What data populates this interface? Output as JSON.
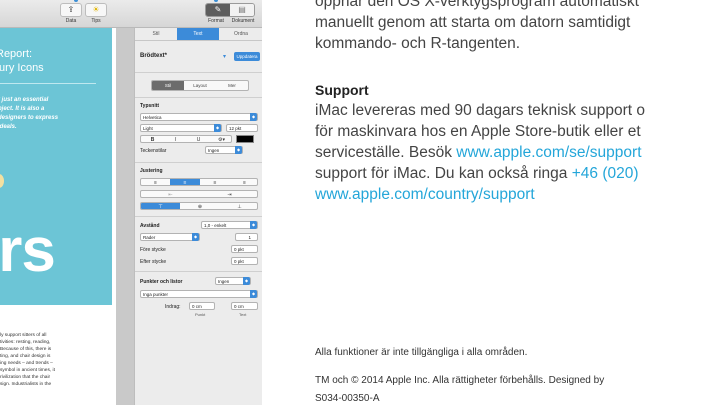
{
  "toolbar": {
    "data_icon_glyph": "⇪",
    "data_label": "Data",
    "tips_icon_glyph": "☀",
    "tips_label": "Tips",
    "format_label": "Format",
    "document_label": "Dokument",
    "format_icon_glyph": "✎",
    "document_icon_glyph": "▤"
  },
  "document": {
    "title_line1": "Report:",
    "title_line2": "tury Icons",
    "quote_lines": [
      "t just an essential",
      "bject. It is also a",
      "designers to express",
      "ideals."
    ],
    "big_word": "irs",
    "body_lines": [
      "ly support sitters of all",
      "tivities: resting, reading,",
      "Because of this, there is",
      "ting, and chair design is",
      "ing needs – and trends –",
      "symbol in ancient times, it",
      "rivilization that the chair",
      "sign. Industrialists in the"
    ],
    "colors": {
      "cover": "#6cc5d6"
    }
  },
  "inspector": {
    "tabs": [
      "Stil",
      "Text",
      "Ordna"
    ],
    "active_tab": "Text",
    "paragraph_style": "Brödtext*",
    "chevron_glyph": "▾",
    "update_button": "Uppdatera",
    "subtabs": [
      "Stil",
      "Layout",
      "Mer"
    ],
    "font_section": "Typsnitt",
    "font_family": "Helvetica",
    "font_weight": "Light",
    "font_size": "12 pkt",
    "style_buttons": [
      "B",
      "I",
      "U",
      "⚙▾"
    ],
    "char_styles_label": "Teckenstilar",
    "char_styles_value": "Ingen",
    "alignment_section": "Justering",
    "align_buttons": [
      "≡",
      "≡",
      "≡",
      "≡"
    ],
    "indent_buttons": [
      "⇤",
      "⇥"
    ],
    "vertical_buttons": [
      "⊤",
      "⊕",
      "⊥"
    ],
    "spacing_label": "Avstånd",
    "spacing_value": "1,0 - enkelt",
    "spacing_mode": "Rader",
    "spacing_lines": "1",
    "before_label": "Före stycke",
    "before_value": "0 pkt",
    "after_label": "Efter stycke",
    "after_value": "0 pkt",
    "bullets_label": "Punkter och listor",
    "bullets_value": "Ingen",
    "bullets_popup": "Inga punkter",
    "indent_label": "Indrag:",
    "indent_bullet_value": "0 cm",
    "indent_text_value": "0 cm",
    "indent_bullet_caption": "Punkt",
    "indent_text_caption": "Text",
    "accent": "#3c8bd9"
  },
  "manual": {
    "line0": "öppnar den OS X-verktygsprogram automatiskt",
    "line1": "manuellt genom att starta om datorn samtidigt",
    "line2": "kommando- och R-tangenten.",
    "support_heading": "Support",
    "support_line1": "iMac levereras med 90 dagars teknisk support o",
    "support_line2": "för maskinvara hos en Apple Store-butik eller et",
    "support_line3a": "serviceställe. Besök ",
    "support_link1": "www.apple.com/se/support",
    "support_line4a": "support för iMac. Du kan också ringa ",
    "support_phone": "+46 (020)",
    "support_link2": "www.apple.com/country/support",
    "footnote": "Alla funktioner är inte tillgängliga i alla områden.",
    "legal_line1": "TM och © 2014 Apple Inc. Alla rättigheter förbehålls. Designed by",
    "legal_line2": "S034-00350-A",
    "link_color": "#24a6d9"
  }
}
